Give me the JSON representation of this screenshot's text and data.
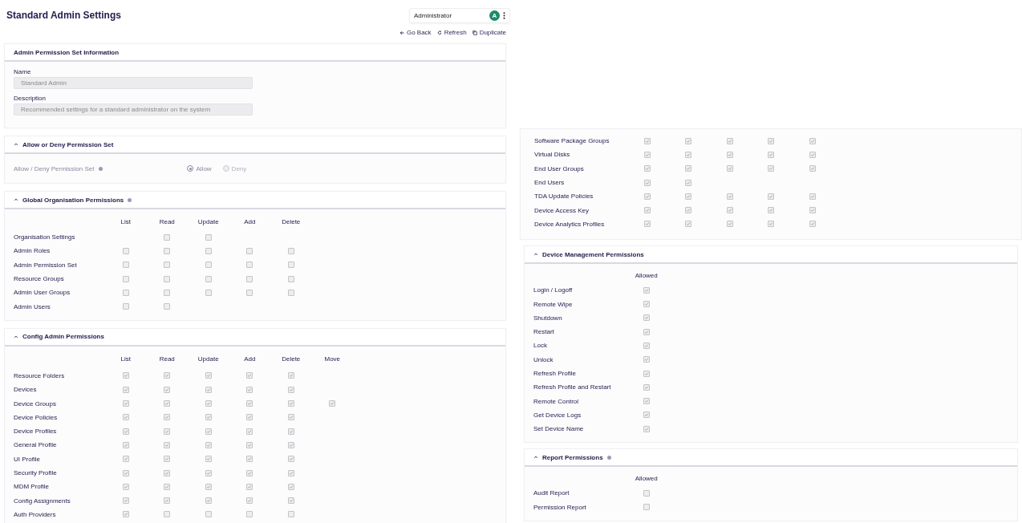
{
  "page_title": "Standard Admin Settings",
  "user_menu": {
    "name": "Administrator",
    "avatar": "A"
  },
  "actions": [
    {
      "label": "Go Back",
      "kind": "back"
    },
    {
      "label": "Refresh",
      "kind": "refresh"
    },
    {
      "label": "Duplicate",
      "kind": "duplicate"
    }
  ],
  "info_card": {
    "title": "Admin Permission Set Information",
    "fields": [
      {
        "label": "Name",
        "value": "Standard Admin"
      },
      {
        "label": "Description",
        "value": "Recommended settings for a standard administrator on the system"
      }
    ]
  },
  "allow_deny": {
    "title": "Allow or Deny Permission Set",
    "expanded": true,
    "label": "Allow / Deny Permission Set",
    "options": [
      {
        "label": "Allow",
        "selected": true
      },
      {
        "label": "Deny",
        "selected": false
      }
    ]
  },
  "global_permissions": {
    "title": "Global Organisation Permissions",
    "expanded": true,
    "info": true,
    "columns": [
      "List",
      "Read",
      "Update",
      "Add",
      "Delete"
    ],
    "rows": [
      {
        "name": "Organisation Settings",
        "cells": [
          {
            "kind": "blank"
          },
          {
            "kind": "checkbox",
            "checked": false
          },
          {
            "kind": "checkbox",
            "checked": false
          }
        ]
      },
      {
        "name": "Admin Roles",
        "cells": [
          {
            "kind": "checkbox",
            "checked": false
          },
          {
            "kind": "checkbox",
            "checked": false
          },
          {
            "kind": "checkbox",
            "checked": false
          },
          {
            "kind": "checkbox",
            "checked": false
          },
          {
            "kind": "checkbox",
            "checked": false
          }
        ]
      },
      {
        "name": "Admin Permission Set",
        "cells": [
          {
            "kind": "checkbox",
            "checked": false
          },
          {
            "kind": "checkbox",
            "checked": false
          },
          {
            "kind": "checkbox",
            "checked": false
          },
          {
            "kind": "checkbox",
            "checked": false
          },
          {
            "kind": "checkbox",
            "checked": false
          }
        ]
      },
      {
        "name": "Resource Groups",
        "cells": [
          {
            "kind": "checkbox",
            "checked": false
          },
          {
            "kind": "checkbox",
            "checked": false
          },
          {
            "kind": "checkbox",
            "checked": false
          },
          {
            "kind": "checkbox",
            "checked": false
          },
          {
            "kind": "checkbox",
            "checked": false
          }
        ]
      },
      {
        "name": "Admin User Groups",
        "cells": [
          {
            "kind": "checkbox",
            "checked": false
          },
          {
            "kind": "checkbox",
            "checked": false
          },
          {
            "kind": "checkbox",
            "checked": false
          },
          {
            "kind": "checkbox",
            "checked": false
          },
          {
            "kind": "checkbox",
            "checked": false
          }
        ]
      },
      {
        "name": "Admin Users",
        "cells": [
          {
            "kind": "checkbox",
            "checked": false
          },
          {
            "kind": "checkbox",
            "checked": false
          }
        ]
      }
    ]
  },
  "config_permissions": {
    "title": "Config Admin Permissions",
    "expanded": true,
    "info": false,
    "columns": [
      "List",
      "Read",
      "Update",
      "Add",
      "Delete",
      "Move"
    ],
    "rows": [
      {
        "name": "Resource Folders",
        "cells": [
          {
            "kind": "checkbox",
            "checked": true
          },
          {
            "kind": "checkbox",
            "checked": true
          },
          {
            "kind": "checkbox",
            "checked": true
          },
          {
            "kind": "checkbox",
            "checked": true
          },
          {
            "kind": "checkbox",
            "checked": true
          }
        ]
      },
      {
        "name": "Devices",
        "cells": [
          {
            "kind": "checkbox",
            "checked": true
          },
          {
            "kind": "checkbox",
            "checked": true
          },
          {
            "kind": "checkbox",
            "checked": true
          },
          {
            "kind": "checkbox",
            "checked": true
          },
          {
            "kind": "checkbox",
            "checked": true
          }
        ]
      },
      {
        "name": "Device Groups",
        "cells": [
          {
            "kind": "checkbox",
            "checked": true
          },
          {
            "kind": "checkbox",
            "checked": true
          },
          {
            "kind": "checkbox",
            "checked": true
          },
          {
            "kind": "checkbox",
            "checked": true
          },
          {
            "kind": "checkbox",
            "checked": true
          },
          {
            "kind": "checkbox",
            "checked": true
          }
        ]
      },
      {
        "name": "Device Policies",
        "cells": [
          {
            "kind": "checkbox",
            "checked": true
          },
          {
            "kind": "checkbox",
            "checked": true
          },
          {
            "kind": "checkbox",
            "checked": true
          },
          {
            "kind": "checkbox",
            "checked": true
          },
          {
            "kind": "checkbox",
            "checked": true
          }
        ]
      },
      {
        "name": "Device Profiles",
        "cells": [
          {
            "kind": "checkbox",
            "checked": true
          },
          {
            "kind": "checkbox",
            "checked": true
          },
          {
            "kind": "checkbox",
            "checked": true
          },
          {
            "kind": "checkbox",
            "checked": true
          },
          {
            "kind": "checkbox",
            "checked": true
          }
        ]
      },
      {
        "name": "General Profile",
        "cells": [
          {
            "kind": "checkbox",
            "checked": true
          },
          {
            "kind": "checkbox",
            "checked": true
          },
          {
            "kind": "checkbox",
            "checked": true
          },
          {
            "kind": "checkbox",
            "checked": true
          },
          {
            "kind": "checkbox",
            "checked": true
          }
        ]
      },
      {
        "name": "UI Profile",
        "cells": [
          {
            "kind": "checkbox",
            "checked": true
          },
          {
            "kind": "checkbox",
            "checked": true
          },
          {
            "kind": "checkbox",
            "checked": true
          },
          {
            "kind": "checkbox",
            "checked": true
          },
          {
            "kind": "checkbox",
            "checked": true
          }
        ]
      },
      {
        "name": "Security Profile",
        "cells": [
          {
            "kind": "checkbox",
            "checked": true
          },
          {
            "kind": "checkbox",
            "checked": true
          },
          {
            "kind": "checkbox",
            "checked": true
          },
          {
            "kind": "checkbox",
            "checked": true
          },
          {
            "kind": "checkbox",
            "checked": true
          }
        ]
      },
      {
        "name": "MDM Profile",
        "cells": [
          {
            "kind": "checkbox",
            "checked": true
          },
          {
            "kind": "checkbox",
            "checked": true
          },
          {
            "kind": "checkbox",
            "checked": true
          },
          {
            "kind": "checkbox",
            "checked": true
          },
          {
            "kind": "checkbox",
            "checked": true
          }
        ]
      },
      {
        "name": "Config Assignments",
        "cells": [
          {
            "kind": "checkbox",
            "checked": true
          },
          {
            "kind": "checkbox",
            "checked": true
          },
          {
            "kind": "checkbox",
            "checked": true
          },
          {
            "kind": "checkbox",
            "checked": true
          },
          {
            "kind": "checkbox",
            "checked": true
          }
        ]
      },
      {
        "name": "Auth Providers",
        "cells": [
          {
            "kind": "checkbox",
            "checked": true
          },
          {
            "kind": "checkbox",
            "checked": false
          },
          {
            "kind": "checkbox",
            "checked": false
          },
          {
            "kind": "checkbox",
            "checked": false
          },
          {
            "kind": "checkbox",
            "checked": false
          }
        ]
      }
    ]
  },
  "config_permissions_continued": {
    "rows": [
      {
        "name": "Software Package Groups",
        "cells": [
          {
            "kind": "checkbox",
            "checked": true
          },
          {
            "kind": "checkbox",
            "checked": true
          },
          {
            "kind": "checkbox",
            "checked": true
          },
          {
            "kind": "checkbox",
            "checked": true
          },
          {
            "kind": "checkbox",
            "checked": true
          }
        ]
      },
      {
        "name": "Virtual Disks",
        "cells": [
          {
            "kind": "checkbox",
            "checked": true
          },
          {
            "kind": "checkbox",
            "checked": true
          },
          {
            "kind": "checkbox",
            "checked": true
          },
          {
            "kind": "checkbox",
            "checked": true
          },
          {
            "kind": "checkbox",
            "checked": true
          }
        ]
      },
      {
        "name": "End User Groups",
        "cells": [
          {
            "kind": "checkbox",
            "checked": true
          },
          {
            "kind": "checkbox",
            "checked": true
          },
          {
            "kind": "checkbox",
            "checked": true
          },
          {
            "kind": "checkbox",
            "checked": true
          },
          {
            "kind": "checkbox",
            "checked": true
          }
        ]
      },
      {
        "name": "End Users",
        "cells": [
          {
            "kind": "checkbox",
            "checked": true
          },
          {
            "kind": "checkbox",
            "checked": true
          }
        ]
      },
      {
        "name": "TDA Update Policies",
        "cells": [
          {
            "kind": "checkbox",
            "checked": true
          },
          {
            "kind": "checkbox",
            "checked": true
          },
          {
            "kind": "checkbox",
            "checked": true
          },
          {
            "kind": "checkbox",
            "checked": true
          },
          {
            "kind": "checkbox",
            "checked": true
          }
        ]
      },
      {
        "name": "Device Access Key",
        "cells": [
          {
            "kind": "checkbox",
            "checked": true
          },
          {
            "kind": "checkbox",
            "checked": true
          },
          {
            "kind": "checkbox",
            "checked": true
          },
          {
            "kind": "checkbox",
            "checked": true
          },
          {
            "kind": "checkbox",
            "checked": true
          }
        ]
      },
      {
        "name": "Device Analytics Profiles",
        "cells": [
          {
            "kind": "checkbox",
            "checked": true
          },
          {
            "kind": "checkbox",
            "checked": true
          },
          {
            "kind": "checkbox",
            "checked": true
          },
          {
            "kind": "checkbox",
            "checked": true
          },
          {
            "kind": "checkbox",
            "checked": true
          }
        ]
      }
    ]
  },
  "device_management_permissions": {
    "title": "Device Management Permissions",
    "expanded": true,
    "info": false,
    "columns": [
      "Allowed"
    ],
    "rows": [
      {
        "name": "Login / Logoff",
        "cells": [
          {
            "kind": "checkbox",
            "checked": true
          }
        ]
      },
      {
        "name": "Remote Wipe",
        "cells": [
          {
            "kind": "checkbox",
            "checked": true
          }
        ]
      },
      {
        "name": "Shutdown",
        "cells": [
          {
            "kind": "checkbox",
            "checked": true
          }
        ]
      },
      {
        "name": "Restart",
        "cells": [
          {
            "kind": "checkbox",
            "checked": true
          }
        ]
      },
      {
        "name": "Lock",
        "cells": [
          {
            "kind": "checkbox",
            "checked": true
          }
        ]
      },
      {
        "name": "Unlock",
        "cells": [
          {
            "kind": "checkbox",
            "checked": true
          }
        ]
      },
      {
        "name": "Refresh Profile",
        "cells": [
          {
            "kind": "checkbox",
            "checked": true
          }
        ]
      },
      {
        "name": "Refresh Profile and Restart",
        "cells": [
          {
            "kind": "checkbox",
            "checked": true
          }
        ]
      },
      {
        "name": "Remote Control",
        "cells": [
          {
            "kind": "checkbox",
            "checked": true
          }
        ]
      },
      {
        "name": "Get Device Logs",
        "cells": [
          {
            "kind": "checkbox",
            "checked": true
          }
        ]
      },
      {
        "name": "Set Device Name",
        "cells": [
          {
            "kind": "checkbox",
            "checked": true
          }
        ]
      }
    ]
  },
  "report_permissions": {
    "title": "Report Permissions",
    "expanded": true,
    "info": true,
    "columns": [
      "Allowed"
    ],
    "rows": [
      {
        "name": "Audit Report",
        "cells": [
          {
            "kind": "checkbox",
            "checked": false
          }
        ]
      },
      {
        "name": "Permission Report",
        "cells": [
          {
            "kind": "checkbox",
            "checked": false
          }
        ]
      }
    ]
  }
}
